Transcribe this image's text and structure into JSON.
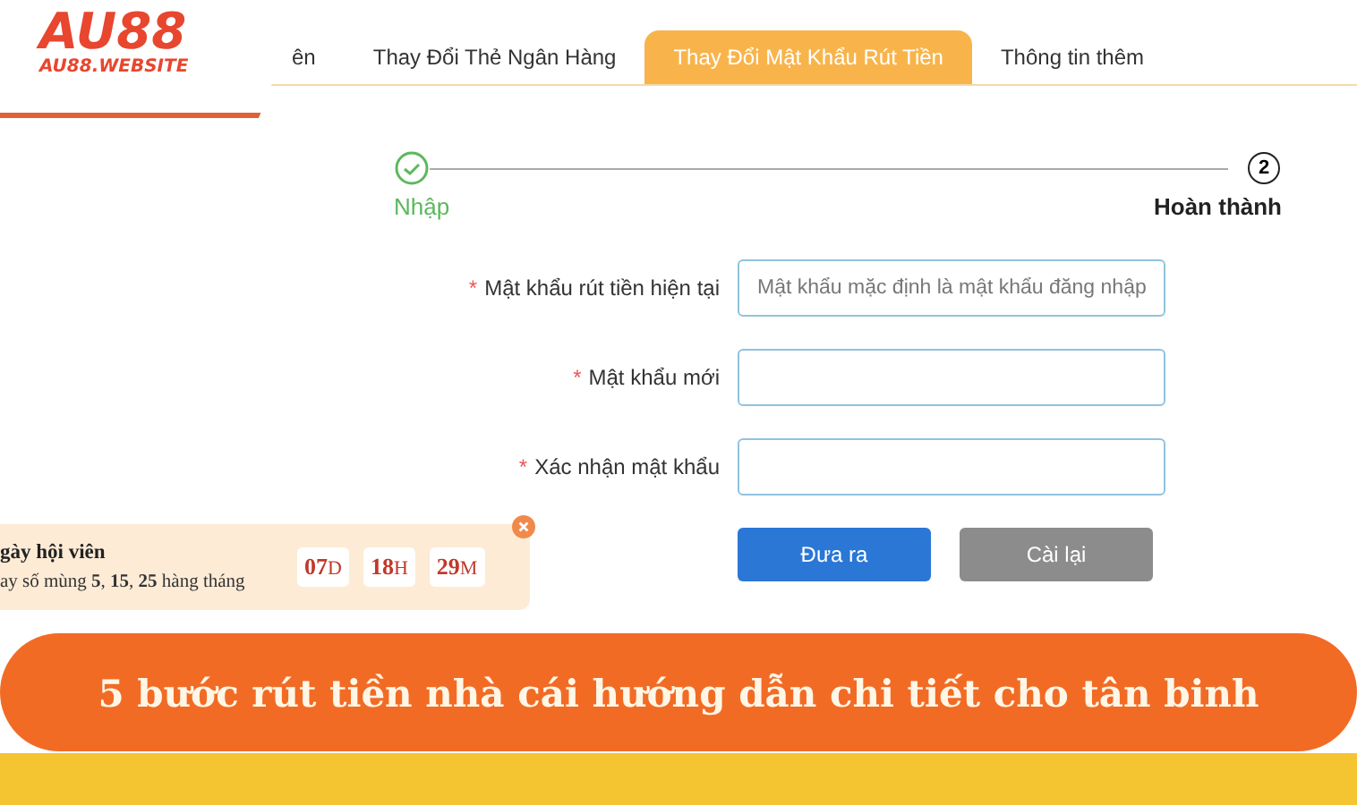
{
  "logo": {
    "mark": "AU88",
    "site": "AU88.WEBSITE"
  },
  "tabs": [
    {
      "label": "ên",
      "selected": false
    },
    {
      "label": "Thay Đổi Thẻ Ngân Hàng",
      "selected": false
    },
    {
      "label": "Thay Đổi Mật Khẩu Rút Tiền",
      "selected": true
    },
    {
      "label": "Thông tin thêm",
      "selected": false
    }
  ],
  "steps": [
    {
      "label": "Nhập",
      "done": true
    },
    {
      "label": "Hoàn thành",
      "marker": "2",
      "done": false
    }
  ],
  "fields": [
    {
      "mark": "*",
      "label": "Mật khẩu rút tiền hiện tại",
      "placeholder": "Mật khẩu mặc định là mật khẩu đăng nhập"
    },
    {
      "mark": "*",
      "label": "Mật khẩu mới"
    },
    {
      "mark": "*",
      "label": "Xác nhận mật khẩu"
    }
  ],
  "buttons": [
    {
      "label": "Đưa ra",
      "kind": "primary"
    },
    {
      "label": "Cài lại",
      "kind": "secondary"
    }
  ],
  "promo": {
    "title": "gày hội viên",
    "text": "ay số mùng **5**, **15**, **25** hàng tháng",
    "countdown": [
      {
        "value": "07",
        "unit": "D"
      },
      {
        "value": "18",
        "unit": "H"
      },
      {
        "value": "29",
        "unit": "M"
      }
    ]
  },
  "banner": {
    "title": "5 bước rút tiền nhà cái hướng dẫn chi tiết cho tân binh"
  }
}
